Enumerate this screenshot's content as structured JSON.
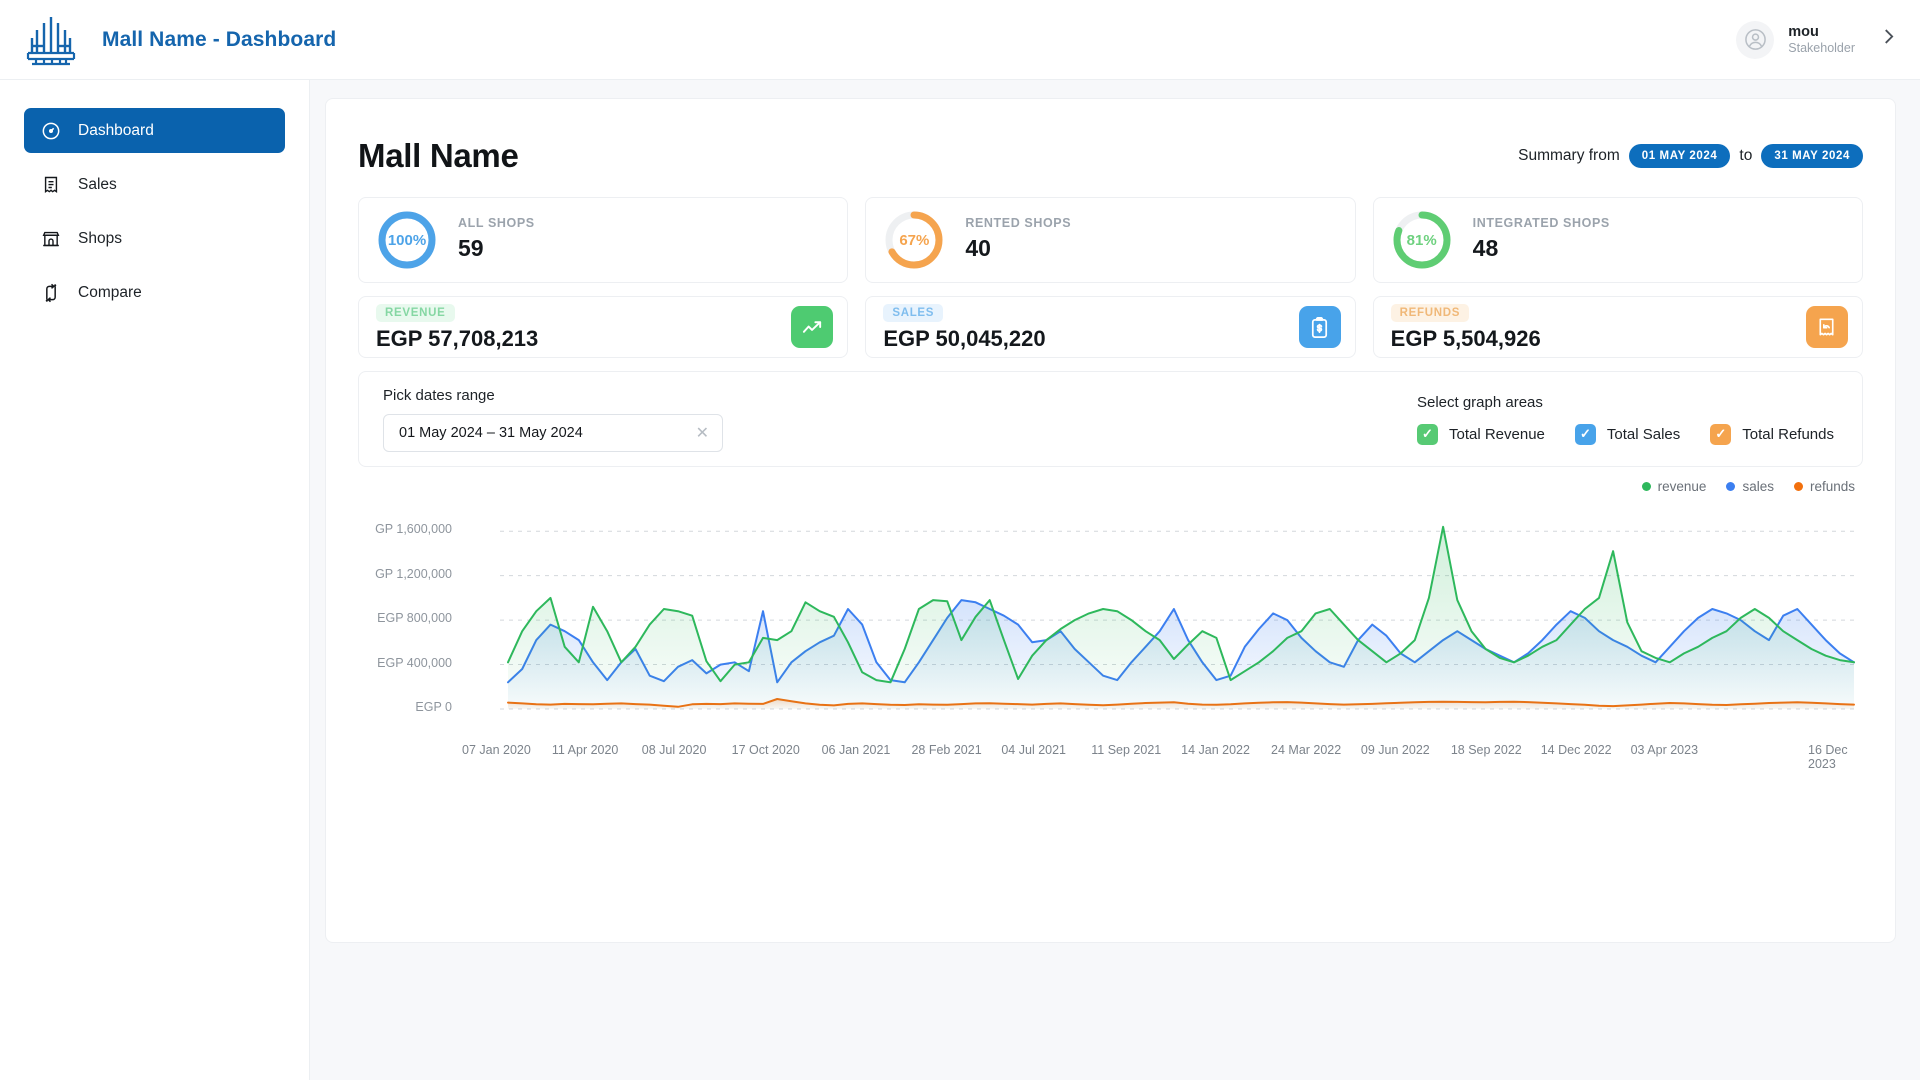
{
  "header": {
    "brand_title": "Mall Name - Dashboard",
    "logo_icon": "mall-arabic-calligraphy-logo",
    "user_name": "mou",
    "user_role": "Stakeholder",
    "avatar_icon": "user-avatar-icon",
    "chevron_icon": "chevron-right-icon"
  },
  "sidebar": {
    "items": [
      {
        "label": "Dashboard",
        "icon": "speedometer-icon",
        "active": true
      },
      {
        "label": "Sales",
        "icon": "receipt-icon",
        "active": false
      },
      {
        "label": "Shops",
        "icon": "store-icon",
        "active": false
      },
      {
        "label": "Compare",
        "icon": "compare-arrows-icon",
        "active": false
      }
    ]
  },
  "page": {
    "title": "Mall Name",
    "summary_prefix": "Summary from",
    "summary_from": "01 MAY 2024",
    "summary_join": "to",
    "summary_to": "31 MAY 2024"
  },
  "stat_cards": [
    {
      "label": "ALL SHOPS",
      "value": "59",
      "percent_text": "100%",
      "percent": 100,
      "color": "#4da3e8"
    },
    {
      "label": "RENTED SHOPS",
      "value": "40",
      "percent_text": "67%",
      "percent": 67,
      "color": "#f5a košar"
    },
    {
      "label": "INTEGRATED SHOPS",
      "value": "48",
      "percent_text": "81%",
      "percent": 81,
      "color": "#5fcd73"
    }
  ],
  "money_cards": [
    {
      "tag": "REVENUE",
      "value": "EGP 57,708,213",
      "icon": "trending-up-icon",
      "color": "#4ecb71",
      "tag_bg": "#e8f9ee",
      "tag_fg": "#7fd6a0"
    },
    {
      "tag": "SALES",
      "value": "EGP 50,045,220",
      "icon": "clipboard-dollar-icon",
      "color": "#48a3ea",
      "tag_bg": "#e8f3fd",
      "tag_fg": "#7fbdee"
    },
    {
      "tag": "REFUNDS",
      "value": "EGP 5,504,926",
      "icon": "receipt-return-icon",
      "color": "#f5a council",
      "tag_bg": "#fdf2e4",
      "tag_fg": "#f0b878"
    }
  ],
  "controls": {
    "date_label": "Pick dates range",
    "date_value": "01 May 2024 – 31 May 2024",
    "clear_icon": "close-icon",
    "graph_label": "Select graph areas",
    "checkboxes": [
      {
        "label": "Total Revenue",
        "checked": true,
        "color": "#57ca74"
      },
      {
        "label": "Total Sales",
        "checked": true,
        "color": "#48a3ea"
      },
      {
        "label": "Total Refunds",
        "checked": true,
        "color": "#f5a44e"
      }
    ]
  },
  "chart_data": {
    "type": "area",
    "title": "",
    "xlabel": "",
    "ylabel": "",
    "grid": true,
    "legend_position": "top-right",
    "ylim": [
      0,
      1800000
    ],
    "yticks": [
      0,
      400000,
      800000,
      1200000,
      1600000
    ],
    "ytick_labels": [
      "EGP 0",
      "EGP 400,000",
      "EGP 800,000",
      "GP 1,200,000",
      "GP 1,600,000"
    ],
    "xtick_labels": [
      "07 Jan 2020",
      "11 Apr 2020",
      "08 Jul 2020",
      "17 Oct 2020",
      "06 Jan 2021",
      "28 Feb 2021",
      "04 Jul 2021",
      "11 Sep 2021",
      "14 Jan 2022",
      "24 Mar 2022",
      "09 Jun 2022",
      "18 Sep 2022",
      "14 Dec 2022",
      "03 Apr 2023",
      "16 Dec 2023"
    ],
    "legend": [
      {
        "name": "revenue",
        "color": "#2eb85c"
      },
      {
        "name": "sales",
        "color": "#3c7ff0"
      },
      {
        "name": "refunds",
        "color": "#f2700d"
      }
    ],
    "series": [
      {
        "name": "revenue",
        "color": "#2eb85c",
        "fill": "rgba(46,184,92,0.13)",
        "values": [
          420000,
          700000,
          880000,
          1000000,
          560000,
          420000,
          920000,
          700000,
          420000,
          560000,
          760000,
          900000,
          880000,
          840000,
          430000,
          250000,
          400000,
          420000,
          640000,
          620000,
          700000,
          960000,
          880000,
          830000,
          600000,
          330000,
          260000,
          240000,
          540000,
          900000,
          980000,
          970000,
          620000,
          830000,
          980000,
          620000,
          270000,
          480000,
          620000,
          720000,
          800000,
          860000,
          900000,
          880000,
          800000,
          700000,
          620000,
          450000,
          580000,
          700000,
          640000,
          260000,
          340000,
          420000,
          520000,
          640000,
          700000,
          860000,
          900000,
          760000,
          620000,
          520000,
          420000,
          500000,
          620000,
          1000000,
          1640000,
          980000,
          700000,
          540000,
          460000,
          420000,
          480000,
          560000,
          620000,
          760000,
          900000,
          1000000,
          1420000,
          780000,
          520000,
          460000,
          420000,
          500000,
          560000,
          640000,
          700000,
          820000,
          900000,
          820000,
          700000,
          620000,
          540000,
          480000,
          440000,
          420000
        ]
      },
      {
        "name": "sales",
        "color": "#3c7ff0",
        "fill": "rgba(60,127,240,0.13)",
        "values": [
          240000,
          360000,
          620000,
          760000,
          700000,
          620000,
          420000,
          260000,
          420000,
          540000,
          300000,
          250000,
          380000,
          440000,
          320000,
          400000,
          420000,
          340000,
          880000,
          240000,
          420000,
          520000,
          600000,
          660000,
          900000,
          760000,
          420000,
          260000,
          240000,
          420000,
          620000,
          820000,
          980000,
          960000,
          900000,
          840000,
          760000,
          600000,
          620000,
          700000,
          540000,
          420000,
          300000,
          260000,
          420000,
          560000,
          700000,
          900000,
          620000,
          420000,
          260000,
          300000,
          560000,
          720000,
          860000,
          800000,
          640000,
          520000,
          420000,
          380000,
          620000,
          760000,
          660000,
          500000,
          420000,
          520000,
          620000,
          700000,
          620000,
          540000,
          480000,
          420000,
          500000,
          620000,
          760000,
          880000,
          820000,
          700000,
          620000,
          560000,
          480000,
          420000,
          560000,
          700000,
          820000,
          900000,
          860000,
          800000,
          700000,
          620000,
          840000,
          900000,
          760000,
          620000,
          500000,
          420000
        ]
      },
      {
        "name": "refunds",
        "color": "#f2700d",
        "fill": "rgba(242,112,13,0.12)",
        "values": [
          58000,
          50000,
          42000,
          40000,
          46000,
          44000,
          42000,
          48000,
          50000,
          44000,
          40000,
          30000,
          20000,
          42000,
          46000,
          44000,
          50000,
          48000,
          46000,
          90000,
          70000,
          50000,
          38000,
          32000,
          46000,
          50000,
          44000,
          38000,
          36000,
          42000,
          40000,
          38000,
          44000,
          50000,
          52000,
          48000,
          44000,
          40000,
          46000,
          50000,
          44000,
          38000,
          34000,
          40000,
          48000,
          54000,
          58000,
          60000,
          48000,
          40000,
          38000,
          42000,
          50000,
          56000,
          60000,
          62000,
          58000,
          50000,
          44000,
          40000,
          42000,
          46000,
          52000,
          56000,
          60000,
          64000,
          66000,
          64000,
          62000,
          60000,
          64000,
          66000,
          62000,
          56000,
          50000,
          44000,
          38000,
          30000,
          26000,
          32000,
          40000,
          48000,
          54000,
          50000,
          44000,
          38000,
          36000,
          42000,
          48000,
          54000,
          58000,
          60000,
          56000,
          50000,
          44000,
          40000
        ]
      }
    ]
  }
}
